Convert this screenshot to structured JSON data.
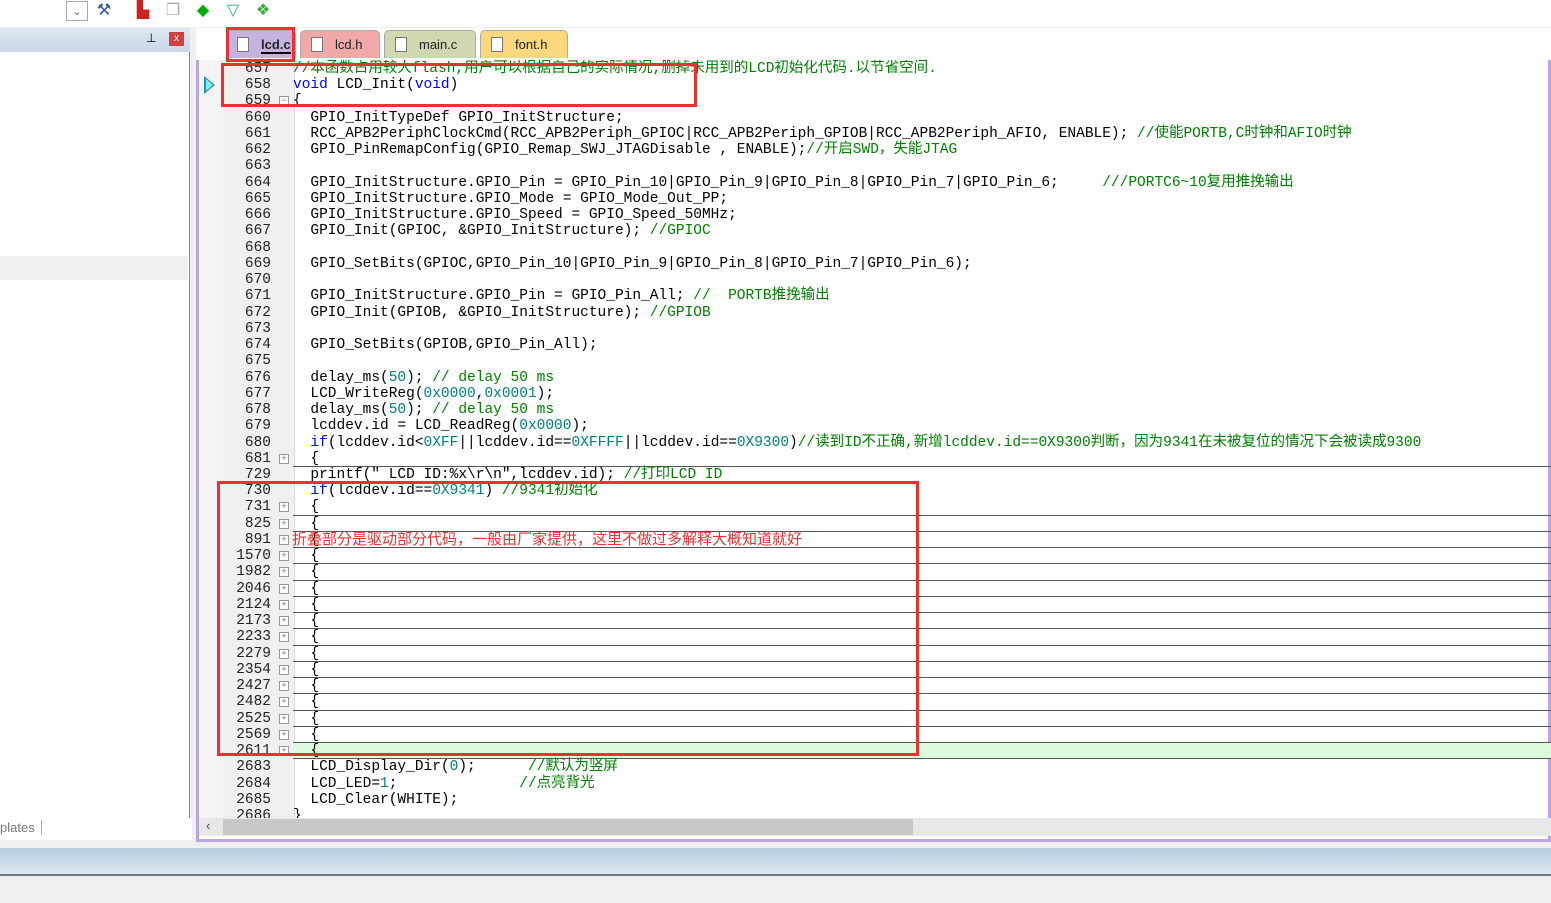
{
  "toolbar": {
    "icons": [
      "dropdown-icon",
      "wand-icon",
      "build-icon",
      "windows-icon",
      "diamond-icon",
      "filter-icon",
      "multi-diamond-icon"
    ]
  },
  "left_panel": {
    "pin": "📌",
    "close": "x",
    "bottom_tab": "plates"
  },
  "tabs": [
    {
      "label": "lcd.c",
      "color": "#c4b2e0",
      "active": true
    },
    {
      "label": "lcd.h",
      "color": "#f0a8a8",
      "active": false
    },
    {
      "label": "main.c",
      "color": "#cfd8b0",
      "active": false
    },
    {
      "label": "font.h",
      "color": "#fbd77e",
      "active": false
    }
  ],
  "annotation": "折叠部分是驱动部分代码，一般由厂家提供，这里不做过多解释大概知道就好",
  "lines": [
    {
      "n": "657",
      "seg": [
        [
          "c",
          "//本函数占用较大flash,用户可以根据自己的实际情况,删掉未用到的LCD初始化代码.以节省空间."
        ]
      ]
    },
    {
      "n": "658",
      "seg": [
        [
          "k",
          "void"
        ],
        [
          "t",
          " LCD_Init("
        ],
        [
          "k",
          "void"
        ],
        [
          "t",
          ")"
        ]
      ]
    },
    {
      "n": "659",
      "fold": "−",
      "seg": [
        [
          "t",
          "{"
        ]
      ]
    },
    {
      "n": "660",
      "seg": [
        [
          "t",
          "  GPIO_InitTypeDef GPIO_InitStructure;"
        ]
      ]
    },
    {
      "n": "661",
      "seg": [
        [
          "t",
          "  RCC_APB2PeriphClockCmd(RCC_APB2Periph_GPIOC|RCC_APB2Periph_GPIOB|RCC_APB2Periph_AFIO, ENABLE); "
        ],
        [
          "c",
          "//使能PORTB,C时钟和AFIO时钟"
        ]
      ]
    },
    {
      "n": "662",
      "seg": [
        [
          "t",
          "  GPIO_PinRemapConfig(GPIO_Remap_SWJ_JTAGDisable , ENABLE);"
        ],
        [
          "c",
          "//开启SWD，失能JTAG"
        ]
      ]
    },
    {
      "n": "663",
      "seg": []
    },
    {
      "n": "664",
      "seg": [
        [
          "t",
          "  GPIO_InitStructure.GPIO_Pin = GPIO_Pin_10|GPIO_Pin_9|GPIO_Pin_8|GPIO_Pin_7|GPIO_Pin_6;     "
        ],
        [
          "c",
          "///PORTC6~10复用推挽输出"
        ]
      ]
    },
    {
      "n": "665",
      "seg": [
        [
          "t",
          "  GPIO_InitStructure.GPIO_Mode = GPIO_Mode_Out_PP;"
        ]
      ]
    },
    {
      "n": "666",
      "seg": [
        [
          "t",
          "  GPIO_InitStructure.GPIO_Speed = GPIO_Speed_50MHz;"
        ]
      ]
    },
    {
      "n": "667",
      "seg": [
        [
          "t",
          "  GPIO_Init(GPIOC, &GPIO_InitStructure); "
        ],
        [
          "c",
          "//GPIOC"
        ]
      ]
    },
    {
      "n": "668",
      "seg": []
    },
    {
      "n": "669",
      "seg": [
        [
          "t",
          "  GPIO_SetBits(GPIOC,GPIO_Pin_10|GPIO_Pin_9|GPIO_Pin_8|GPIO_Pin_7|GPIO_Pin_6);"
        ]
      ]
    },
    {
      "n": "670",
      "seg": []
    },
    {
      "n": "671",
      "seg": [
        [
          "t",
          "  GPIO_InitStructure.GPIO_Pin = GPIO_Pin_All; "
        ],
        [
          "c",
          "//  PORTB推挽输出"
        ]
      ]
    },
    {
      "n": "672",
      "seg": [
        [
          "t",
          "  GPIO_Init(GPIOB, &GPIO_InitStructure); "
        ],
        [
          "c",
          "//GPIOB"
        ]
      ]
    },
    {
      "n": "673",
      "seg": []
    },
    {
      "n": "674",
      "seg": [
        [
          "t",
          "  GPIO_SetBits(GPIOB,GPIO_Pin_All);"
        ]
      ]
    },
    {
      "n": "675",
      "seg": []
    },
    {
      "n": "676",
      "seg": [
        [
          "t",
          "  delay_ms("
        ],
        [
          "n",
          "50"
        ],
        [
          "t",
          "); "
        ],
        [
          "c",
          "// delay 50 ms"
        ]
      ]
    },
    {
      "n": "677",
      "seg": [
        [
          "t",
          "  LCD_WriteReg("
        ],
        [
          "n",
          "0x0000"
        ],
        [
          "t",
          ","
        ],
        [
          "n",
          "0x0001"
        ],
        [
          "t",
          ");"
        ]
      ]
    },
    {
      "n": "678",
      "seg": [
        [
          "t",
          "  delay_ms("
        ],
        [
          "n",
          "50"
        ],
        [
          "t",
          "); "
        ],
        [
          "c",
          "// delay 50 ms"
        ]
      ]
    },
    {
      "n": "679",
      "seg": [
        [
          "t",
          "  lcddev.id = LCD_ReadReg("
        ],
        [
          "n",
          "0x0000"
        ],
        [
          "t",
          ");"
        ]
      ]
    },
    {
      "n": "680",
      "seg": [
        [
          "t",
          "  "
        ],
        [
          "k",
          "if"
        ],
        [
          "t",
          "(lcddev.id<"
        ],
        [
          "n",
          "0XFF"
        ],
        [
          "t",
          "||lcddev.id=="
        ],
        [
          "n",
          "0XFFFF"
        ],
        [
          "t",
          "||lcddev.id=="
        ],
        [
          "n",
          "0X9300"
        ],
        [
          "t",
          ")"
        ],
        [
          "c",
          "//读到ID不正确,新增lcddev.id==0X9300判断，因为9341在未被复位的情况下会被读成9300"
        ]
      ]
    },
    {
      "n": "681",
      "fold": "+",
      "folded": true,
      "seg": [
        [
          "t",
          "  {"
        ]
      ]
    },
    {
      "n": "729",
      "seg": [
        [
          "t",
          "  printf(\" LCD ID:%x\\r\\n\",lcddev.id); "
        ],
        [
          "c",
          "//打印LCD ID"
        ]
      ]
    },
    {
      "n": "730",
      "seg": [
        [
          "t",
          "  "
        ],
        [
          "k",
          "if"
        ],
        [
          "t",
          "(lcddev.id=="
        ],
        [
          "n",
          "0X9341"
        ],
        [
          "t",
          ") "
        ],
        [
          "c",
          "//9341初始化"
        ]
      ]
    },
    {
      "n": "731",
      "fold": "+",
      "folded": true,
      "seg": [
        [
          "t",
          "  {"
        ]
      ]
    },
    {
      "n": "825",
      "fold": "+",
      "folded": true,
      "seg": [
        [
          "t",
          "  {"
        ]
      ]
    },
    {
      "n": "891",
      "fold": "+",
      "folded": true,
      "seg": [
        [
          "t",
          "  {"
        ]
      ]
    },
    {
      "n": "1570",
      "fold": "+",
      "folded": true,
      "seg": [
        [
          "t",
          "  {"
        ]
      ]
    },
    {
      "n": "1982",
      "fold": "+",
      "folded": true,
      "seg": [
        [
          "t",
          "  {"
        ]
      ]
    },
    {
      "n": "2046",
      "fold": "+",
      "folded": true,
      "seg": [
        [
          "t",
          "  {"
        ]
      ]
    },
    {
      "n": "2124",
      "fold": "+",
      "folded": true,
      "seg": [
        [
          "t",
          "  {"
        ]
      ]
    },
    {
      "n": "2173",
      "fold": "+",
      "folded": true,
      "seg": [
        [
          "t",
          "  {"
        ]
      ]
    },
    {
      "n": "2233",
      "fold": "+",
      "folded": true,
      "seg": [
        [
          "t",
          "  {"
        ]
      ]
    },
    {
      "n": "2279",
      "fold": "+",
      "folded": true,
      "seg": [
        [
          "t",
          "  {"
        ]
      ]
    },
    {
      "n": "2354",
      "fold": "+",
      "folded": true,
      "seg": [
        [
          "t",
          "  {"
        ]
      ]
    },
    {
      "n": "2427",
      "fold": "+",
      "folded": true,
      "seg": [
        [
          "t",
          "  {"
        ]
      ]
    },
    {
      "n": "2482",
      "fold": "+",
      "folded": true,
      "seg": [
        [
          "t",
          "  {"
        ]
      ]
    },
    {
      "n": "2525",
      "fold": "+",
      "folded": true,
      "seg": [
        [
          "t",
          "  {"
        ]
      ]
    },
    {
      "n": "2569",
      "fold": "+",
      "folded": true,
      "seg": [
        [
          "t",
          "  {"
        ]
      ]
    },
    {
      "n": "2611",
      "fold": "+",
      "folded": true,
      "hl": true,
      "seg": [
        [
          "t",
          "  {"
        ]
      ]
    },
    {
      "n": "2683",
      "seg": [
        [
          "t",
          "  LCD_Display_Dir("
        ],
        [
          "n",
          "0"
        ],
        [
          "t",
          ");      "
        ],
        [
          "c",
          "//默认为竖屏"
        ]
      ]
    },
    {
      "n": "2684",
      "seg": [
        [
          "t",
          "  LCD_LED="
        ],
        [
          "n",
          "1"
        ],
        [
          "t",
          ";              "
        ],
        [
          "c",
          "//点亮背光"
        ]
      ]
    },
    {
      "n": "2685",
      "seg": [
        [
          "t",
          "  LCD_Clear(WHITE);"
        ]
      ]
    },
    {
      "n": "2686",
      "seg": [
        [
          "t",
          "}"
        ]
      ]
    }
  ]
}
